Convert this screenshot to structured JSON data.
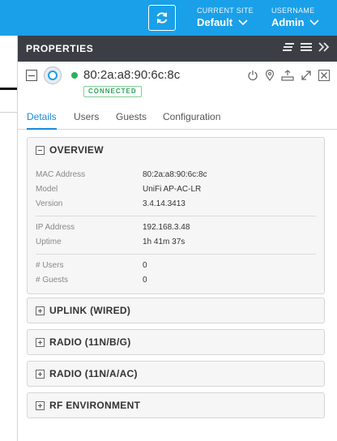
{
  "topbar": {
    "current_site_caption": "CURRENT SITE",
    "current_site_value": "Default",
    "username_caption": "USERNAME",
    "username_value": "Admin"
  },
  "panel": {
    "title": "PROPERTIES"
  },
  "device": {
    "mac": "80:2a:a8:90:6c:8c",
    "status": "CONNECTED"
  },
  "tabs": [
    {
      "label": "Details"
    },
    {
      "label": "Users"
    },
    {
      "label": "Guests"
    },
    {
      "label": "Configuration"
    }
  ],
  "overview": {
    "title": "OVERVIEW",
    "rows": [
      {
        "label": "MAC Address",
        "value": "80:2a:a8:90:6c:8c"
      },
      {
        "label": "Model",
        "value": "UniFi AP-AC-LR"
      },
      {
        "label": "Version",
        "value": "3.4.14.3413"
      },
      {
        "label": "IP Address",
        "value": "192.168.3.48"
      },
      {
        "label": "Uptime",
        "value": "1h 41m 37s"
      },
      {
        "label": "# Users",
        "value": "0"
      },
      {
        "label": "# Guests",
        "value": "0"
      }
    ]
  },
  "sections": [
    {
      "title": "UPLINK (WIRED)"
    },
    {
      "title": "RADIO (11N/B/G)"
    },
    {
      "title": "RADIO (11N/A/AC)"
    },
    {
      "title": "RF ENVIRONMENT"
    }
  ],
  "colors": {
    "topbar": "#1aa0e8",
    "panel_header": "#3b3f45",
    "connected": "#27b35b",
    "active_tab": "#1a8ad8"
  }
}
